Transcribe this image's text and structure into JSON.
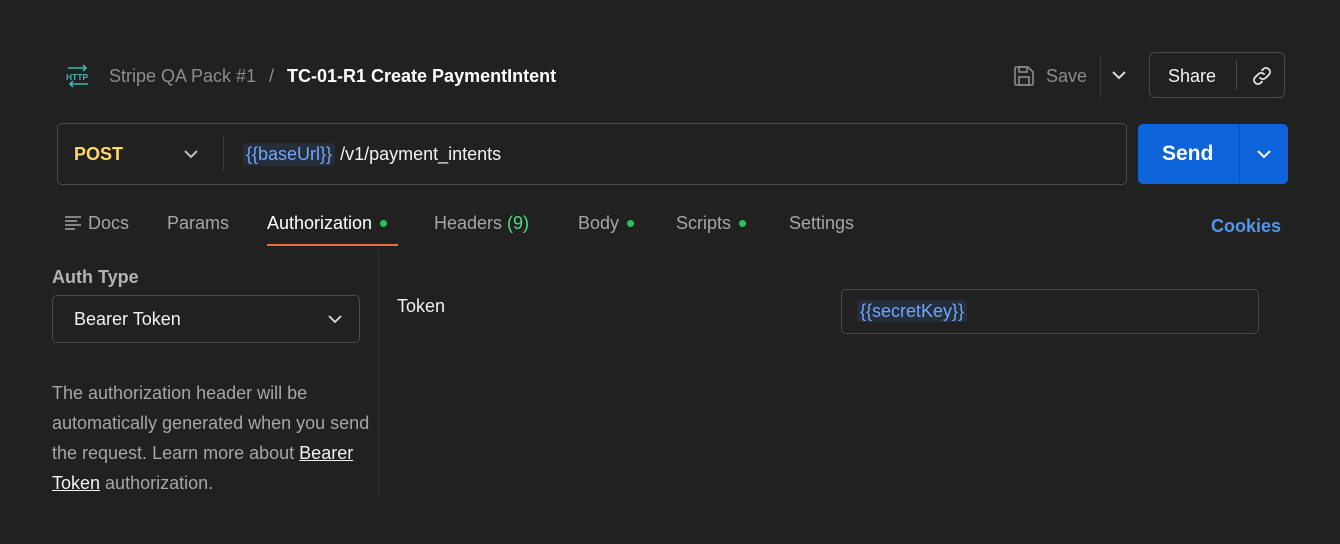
{
  "breadcrumb": {
    "method_badge": "HTTP",
    "collection": "Stripe QA Pack #1",
    "separator": "/",
    "request_name": "TC-01-R1 Create PaymentIntent"
  },
  "header_actions": {
    "save_label": "Save",
    "share_label": "Share"
  },
  "request": {
    "method": "POST",
    "url_variable": "{{baseUrl}}",
    "url_path": "/v1/payment_intents",
    "send_label": "Send"
  },
  "tabs": [
    {
      "label": "Docs",
      "active": false
    },
    {
      "label": "Params",
      "active": false
    },
    {
      "label": "Authorization",
      "active": true,
      "dot": true
    },
    {
      "label": "Headers",
      "count": "(9)",
      "active": false
    },
    {
      "label": "Body",
      "active": false,
      "dot": true
    },
    {
      "label": "Scripts",
      "active": false,
      "dot": true
    },
    {
      "label": "Settings",
      "active": false
    }
  ],
  "cookies_label": "Cookies",
  "auth": {
    "type_label": "Auth Type",
    "type_value": "Bearer Token",
    "description_before": "The authorization header will be automatically generated when you send the request. Learn more about ",
    "description_link": "Bearer Token",
    "description_after": " authorization.",
    "token_label": "Token",
    "token_value": "{{secretKey}}"
  },
  "colors": {
    "background": "#212121",
    "accent_tab": "#f26b3a",
    "send_button": "#0d63d9",
    "method_post": "#ffd966",
    "variable": "#6ea8fe",
    "status_dot": "#22c55e"
  }
}
